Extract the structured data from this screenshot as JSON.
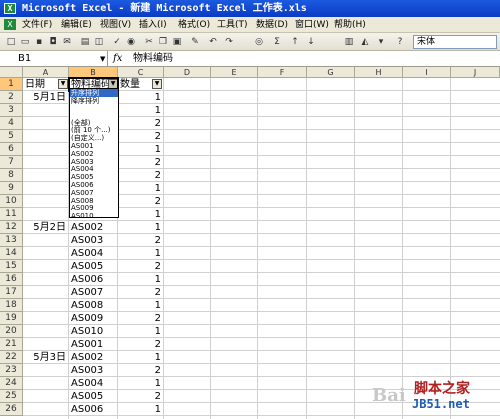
{
  "window": {
    "title": "Microsoft Excel - 新建 Microsoft Excel 工作表.xls"
  },
  "menu": [
    "文件(F)",
    "编辑(E)",
    "视图(V)",
    "插入(I)",
    "格式(O)",
    "工具(T)",
    "数据(D)",
    "窗口(W)",
    "帮助(H)"
  ],
  "toolbar": {
    "font": "宋体",
    "sigma": "Σ"
  },
  "formula": {
    "namebox": "B1",
    "fx": "fx",
    "content": "物料编码"
  },
  "columns": [
    "A",
    "B",
    "C",
    "D",
    "E",
    "F",
    "G",
    "H",
    "I",
    "J"
  ],
  "rows": [
    "1",
    "2",
    "3",
    "4",
    "5",
    "6",
    "7",
    "8",
    "9",
    "10",
    "11",
    "12",
    "13",
    "14",
    "15",
    "16",
    "17",
    "18",
    "19",
    "20",
    "21",
    "22",
    "23",
    "24",
    "25",
    "26"
  ],
  "header": {
    "a": "日期",
    "b": "物料编码",
    "c": "数量"
  },
  "dates": [
    "5月1日",
    "5月2日",
    "5月3日"
  ],
  "codes": [
    "AS001",
    "AS002",
    "AS003",
    "AS004",
    "AS005",
    "AS006",
    "AS007",
    "AS008",
    "AS009",
    "AS010",
    "AS001",
    "AS002",
    "AS003",
    "AS004",
    "AS005",
    "AS006"
  ],
  "quantities": [
    "1",
    "1",
    "2",
    "2",
    "1",
    "2",
    "2",
    "1",
    "2",
    "1",
    "1",
    "2",
    "1",
    "2",
    "1",
    "2",
    "1",
    "2",
    "1",
    "2",
    "1",
    "2",
    "1",
    "2",
    "1"
  ],
  "filter_menu": [
    "升序排列",
    "降序排列",
    "(全部)",
    "(前 10 个...)",
    "(自定义...)",
    "AS001",
    "AS002",
    "AS003",
    "AS004",
    "AS005",
    "AS006",
    "AS007",
    "AS008",
    "AS009",
    "AS010"
  ],
  "watermark": {
    "text1": "Bai",
    "text2": "脚本之家",
    "text3": "JB51.net"
  }
}
